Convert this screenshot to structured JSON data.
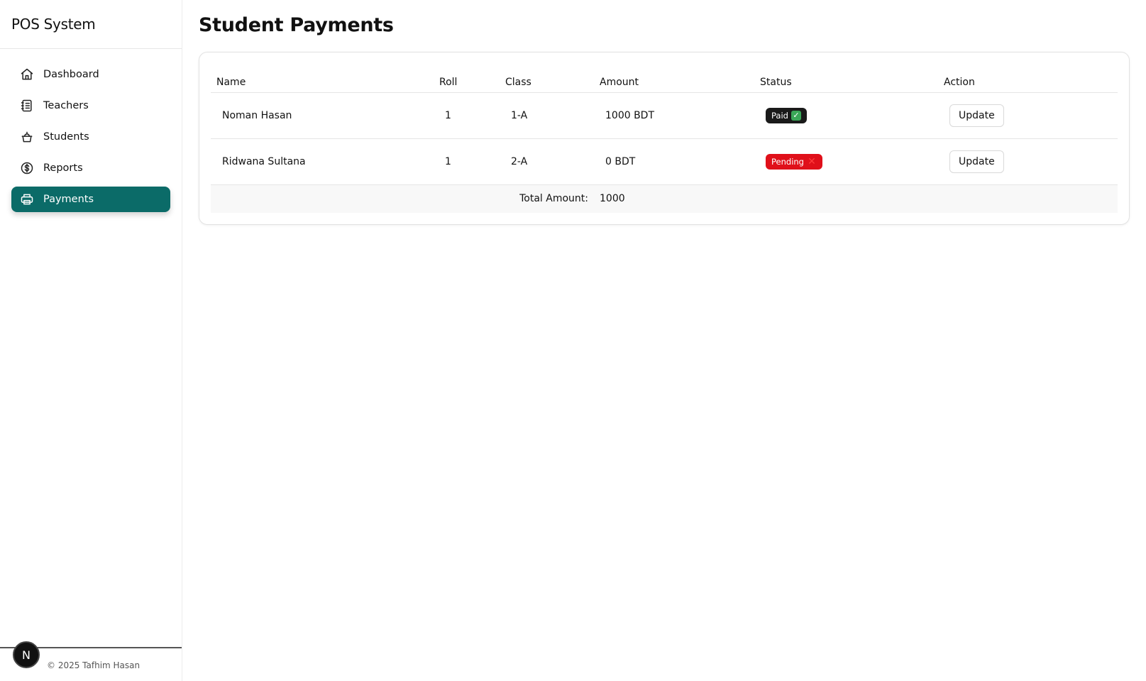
{
  "app": {
    "title": "POS System"
  },
  "sidebar": {
    "items": [
      {
        "label": "Dashboard",
        "icon": "home-icon",
        "active": false
      },
      {
        "label": "Teachers",
        "icon": "notebook-icon",
        "active": false
      },
      {
        "label": "Students",
        "icon": "basket-icon",
        "active": false
      },
      {
        "label": "Reports",
        "icon": "dollar-circle-icon",
        "active": false
      },
      {
        "label": "Payments",
        "icon": "printer-icon",
        "active": true
      }
    ],
    "footer_text": "© 2025 Tafhim Hasan",
    "avatar_letter": "N"
  },
  "main": {
    "title": "Student Payments",
    "table": {
      "headers": {
        "name": "Name",
        "roll": "Roll",
        "class": "Class",
        "amount": "Amount",
        "status": "Status",
        "action": "Action"
      },
      "rows": [
        {
          "name": "Noman Hasan",
          "roll": "1",
          "class": "1-A",
          "amount": "1000 BDT",
          "status": "Paid",
          "status_mark": "✓",
          "action": "Update"
        },
        {
          "name": "Ridwana Sultana",
          "roll": "1",
          "class": "2-A",
          "amount": "0 BDT",
          "status": "Pending",
          "status_mark": "✕",
          "action": "Update"
        }
      ],
      "total_label": "Total Amount:",
      "total_value": "1000"
    }
  },
  "colors": {
    "accent": "#0b6b68",
    "paid": "#1a1a1a",
    "pending": "#e0101a"
  }
}
